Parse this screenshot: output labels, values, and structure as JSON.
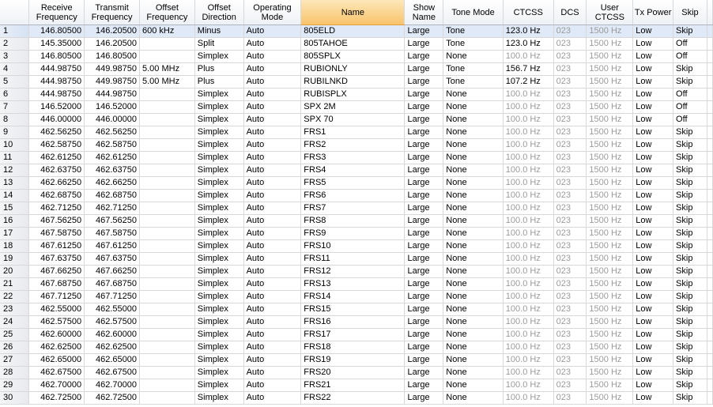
{
  "columns": [
    "",
    "Receive Frequency",
    "Transmit Frequency",
    "Offset Frequency",
    "Offset Direction",
    "Operating Mode",
    "Name",
    "Show Name",
    "Tone Mode",
    "CTCSS",
    "DCS",
    "User CTCSS",
    "Tx Power",
    "Skip"
  ],
  "rows": [
    [
      "1",
      "146.80500",
      "146.20500",
      "600 kHz",
      "Minus",
      "Auto",
      "805ELD",
      "Large",
      "Tone",
      "123.0 Hz",
      "023",
      "1500 Hz",
      "Low",
      "Skip"
    ],
    [
      "2",
      "145.35000",
      "146.20500",
      "",
      "Split",
      "Auto",
      "805TAHOE",
      "Large",
      "Tone",
      "123.0 Hz",
      "023",
      "1500 Hz",
      "Low",
      "Off"
    ],
    [
      "3",
      "146.80500",
      "146.80500",
      "",
      "Simplex",
      "Auto",
      "805SPLX",
      "Large",
      "None",
      "100.0 Hz",
      "023",
      "1500 Hz",
      "Low",
      "Off"
    ],
    [
      "4",
      "444.98750",
      "449.98750",
      "5.00 MHz",
      "Plus",
      "Auto",
      "RUBIONLY",
      "Large",
      "Tone",
      "156.7 Hz",
      "023",
      "1500 Hz",
      "Low",
      "Skip"
    ],
    [
      "5",
      "444.98750",
      "449.98750",
      "5.00 MHz",
      "Plus",
      "Auto",
      "RUBILNKD",
      "Large",
      "Tone",
      "107.2 Hz",
      "023",
      "1500 Hz",
      "Low",
      "Skip"
    ],
    [
      "6",
      "444.98750",
      "444.98750",
      "",
      "Simplex",
      "Auto",
      "RUBISPLX",
      "Large",
      "None",
      "100.0 Hz",
      "023",
      "1500 Hz",
      "Low",
      "Off"
    ],
    [
      "7",
      "146.52000",
      "146.52000",
      "",
      "Simplex",
      "Auto",
      "SPX 2M",
      "Large",
      "None",
      "100.0 Hz",
      "023",
      "1500 Hz",
      "Low",
      "Off"
    ],
    [
      "8",
      "446.00000",
      "446.00000",
      "",
      "Simplex",
      "Auto",
      "SPX 70",
      "Large",
      "None",
      "100.0 Hz",
      "023",
      "1500 Hz",
      "Low",
      "Off"
    ],
    [
      "9",
      "462.56250",
      "462.56250",
      "",
      "Simplex",
      "Auto",
      "FRS1",
      "Large",
      "None",
      "100.0 Hz",
      "023",
      "1500 Hz",
      "Low",
      "Skip"
    ],
    [
      "10",
      "462.58750",
      "462.58750",
      "",
      "Simplex",
      "Auto",
      "FRS2",
      "Large",
      "None",
      "100.0 Hz",
      "023",
      "1500 Hz",
      "Low",
      "Skip"
    ],
    [
      "11",
      "462.61250",
      "462.61250",
      "",
      "Simplex",
      "Auto",
      "FRS3",
      "Large",
      "None",
      "100.0 Hz",
      "023",
      "1500 Hz",
      "Low",
      "Skip"
    ],
    [
      "12",
      "462.63750",
      "462.63750",
      "",
      "Simplex",
      "Auto",
      "FRS4",
      "Large",
      "None",
      "100.0 Hz",
      "023",
      "1500 Hz",
      "Low",
      "Skip"
    ],
    [
      "13",
      "462.66250",
      "462.66250",
      "",
      "Simplex",
      "Auto",
      "FRS5",
      "Large",
      "None",
      "100.0 Hz",
      "023",
      "1500 Hz",
      "Low",
      "Skip"
    ],
    [
      "14",
      "462.68750",
      "462.68750",
      "",
      "Simplex",
      "Auto",
      "FRS6",
      "Large",
      "None",
      "100.0 Hz",
      "023",
      "1500 Hz",
      "Low",
      "Skip"
    ],
    [
      "15",
      "462.71250",
      "462.71250",
      "",
      "Simplex",
      "Auto",
      "FRS7",
      "Large",
      "None",
      "100.0 Hz",
      "023",
      "1500 Hz",
      "Low",
      "Skip"
    ],
    [
      "16",
      "467.56250",
      "467.56250",
      "",
      "Simplex",
      "Auto",
      "FRS8",
      "Large",
      "None",
      "100.0 Hz",
      "023",
      "1500 Hz",
      "Low",
      "Skip"
    ],
    [
      "17",
      "467.58750",
      "467.58750",
      "",
      "Simplex",
      "Auto",
      "FRS9",
      "Large",
      "None",
      "100.0 Hz",
      "023",
      "1500 Hz",
      "Low",
      "Skip"
    ],
    [
      "18",
      "467.61250",
      "467.61250",
      "",
      "Simplex",
      "Auto",
      "FRS10",
      "Large",
      "None",
      "100.0 Hz",
      "023",
      "1500 Hz",
      "Low",
      "Skip"
    ],
    [
      "19",
      "467.63750",
      "467.63750",
      "",
      "Simplex",
      "Auto",
      "FRS11",
      "Large",
      "None",
      "100.0 Hz",
      "023",
      "1500 Hz",
      "Low",
      "Skip"
    ],
    [
      "20",
      "467.66250",
      "467.66250",
      "",
      "Simplex",
      "Auto",
      "FRS12",
      "Large",
      "None",
      "100.0 Hz",
      "023",
      "1500 Hz",
      "Low",
      "Skip"
    ],
    [
      "21",
      "467.68750",
      "467.68750",
      "",
      "Simplex",
      "Auto",
      "FRS13",
      "Large",
      "None",
      "100.0 Hz",
      "023",
      "1500 Hz",
      "Low",
      "Skip"
    ],
    [
      "22",
      "467.71250",
      "467.71250",
      "",
      "Simplex",
      "Auto",
      "FRS14",
      "Large",
      "None",
      "100.0 Hz",
      "023",
      "1500 Hz",
      "Low",
      "Skip"
    ],
    [
      "23",
      "462.55000",
      "462.55000",
      "",
      "Simplex",
      "Auto",
      "FRS15",
      "Large",
      "None",
      "100.0 Hz",
      "023",
      "1500 Hz",
      "Low",
      "Skip"
    ],
    [
      "24",
      "462.57500",
      "462.57500",
      "",
      "Simplex",
      "Auto",
      "FRS16",
      "Large",
      "None",
      "100.0 Hz",
      "023",
      "1500 Hz",
      "Low",
      "Skip"
    ],
    [
      "25",
      "462.60000",
      "462.60000",
      "",
      "Simplex",
      "Auto",
      "FRS17",
      "Large",
      "None",
      "100.0 Hz",
      "023",
      "1500 Hz",
      "Low",
      "Skip"
    ],
    [
      "26",
      "462.62500",
      "462.62500",
      "",
      "Simplex",
      "Auto",
      "FRS18",
      "Large",
      "None",
      "100.0 Hz",
      "023",
      "1500 Hz",
      "Low",
      "Skip"
    ],
    [
      "27",
      "462.65000",
      "462.65000",
      "",
      "Simplex",
      "Auto",
      "FRS19",
      "Large",
      "None",
      "100.0 Hz",
      "023",
      "1500 Hz",
      "Low",
      "Skip"
    ],
    [
      "28",
      "462.67500",
      "462.67500",
      "",
      "Simplex",
      "Auto",
      "FRS20",
      "Large",
      "None",
      "100.0 Hz",
      "023",
      "1500 Hz",
      "Low",
      "Skip"
    ],
    [
      "29",
      "462.70000",
      "462.70000",
      "",
      "Simplex",
      "Auto",
      "FRS21",
      "Large",
      "None",
      "100.0 Hz",
      "023",
      "1500 Hz",
      "Low",
      "Skip"
    ],
    [
      "30",
      "462.72500",
      "462.72500",
      "",
      "Simplex",
      "Auto",
      "FRS22",
      "Large",
      "None",
      "100.0 Hz",
      "023",
      "1500 Hz",
      "Low",
      "Skip"
    ]
  ],
  "sorted_column": 6,
  "selected_row": 1,
  "colors": {
    "header": "#eef1f5",
    "sorted_header": "#f9c36c",
    "grid_line": "#d8d8d8",
    "dim_text": "#9a9a9a"
  }
}
